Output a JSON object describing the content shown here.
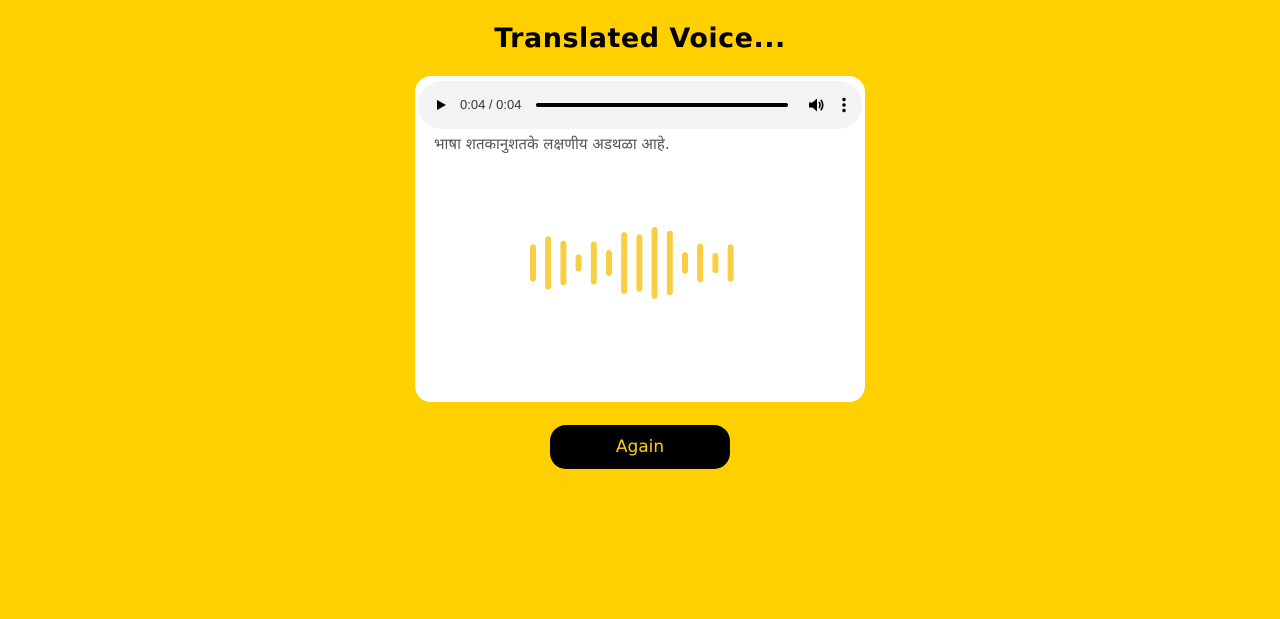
{
  "page": {
    "title": "Translated Voice...",
    "background_color": "#ffd000"
  },
  "audio_player": {
    "time": "0:04 / 0:04",
    "progress_fraction": 1.0,
    "play_icon": "play-icon",
    "volume_icon": "volume-icon",
    "more_icon": "more-vertical-icon"
  },
  "translation": {
    "text": "भाषा शतकानुशतके लक्षणीय अडथळा आहे."
  },
  "waveform": {
    "color": "#f7cf44",
    "levels": [
      0.52,
      0.74,
      0.62,
      0.24,
      0.6,
      0.36,
      0.86,
      0.8,
      1.0,
      0.9,
      0.3,
      0.54,
      0.28,
      0.52
    ]
  },
  "again_button": {
    "label": "Again",
    "text_color": "#ffd000",
    "background_color": "#000000"
  }
}
